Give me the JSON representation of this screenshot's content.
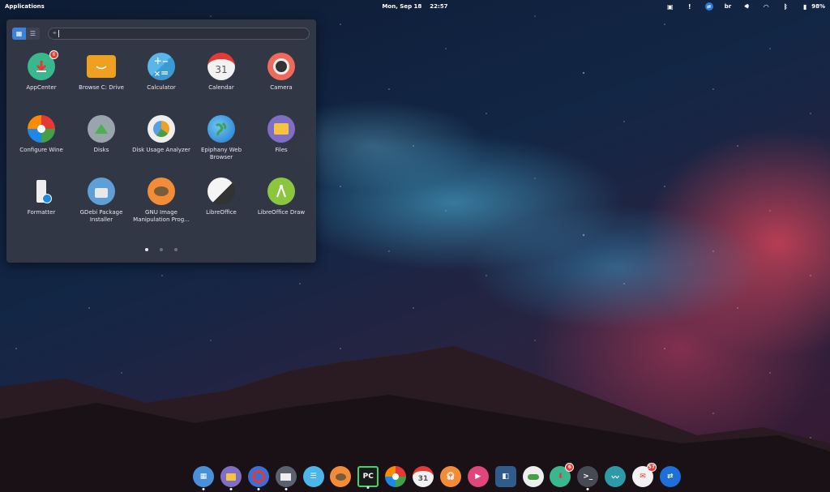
{
  "panel": {
    "applications": "Applications",
    "date": "Mon, Sep 18",
    "time": "22:57",
    "keyboard": "br",
    "battery": "98%"
  },
  "launcher": {
    "search_placeholder": "",
    "apps": [
      {
        "label": "AppCenter",
        "badge": "6"
      },
      {
        "label": "Browse C: Drive"
      },
      {
        "label": "Calculator"
      },
      {
        "label": "Calendar",
        "day": "31"
      },
      {
        "label": "Camera"
      },
      {
        "label": "Configure Wine"
      },
      {
        "label": "Disks"
      },
      {
        "label": "Disk Usage Analyzer"
      },
      {
        "label": "Epiphany Web Browser"
      },
      {
        "label": "Files"
      },
      {
        "label": "Formatter"
      },
      {
        "label": "GDebi Package Installer"
      },
      {
        "label": "GNU Image Manipulation Prog..."
      },
      {
        "label": "LibreOffice"
      },
      {
        "label": "LibreOffice Draw"
      }
    ]
  },
  "dock": {
    "pycharm_label": "PC",
    "calendar_day": "31",
    "appcenter_badge": "6",
    "mail_badge": "57",
    "terminal_label": ">_"
  },
  "colors": {
    "accent": "#3b83d8",
    "badge": "#e53935"
  }
}
